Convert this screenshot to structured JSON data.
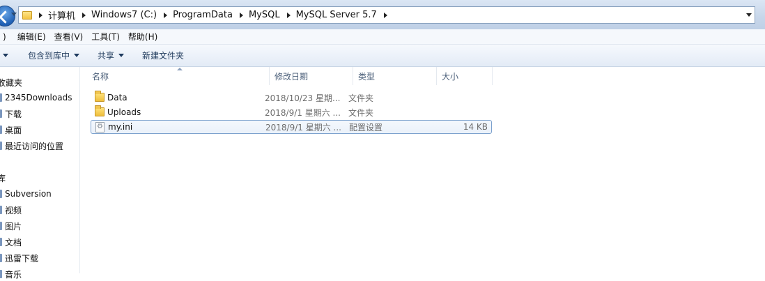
{
  "address_bar": {
    "breadcrumbs": [
      "计算机",
      "Windows7 (C:)",
      "ProgramData",
      "MySQL",
      "MySQL Server 5.7"
    ]
  },
  "menu": {
    "items": [
      "编辑(E)",
      "查看(V)",
      "工具(T)",
      "帮助(H)"
    ],
    "partial_first": ")"
  },
  "toolbar": {
    "include_in_library": "包含到库中",
    "share": "共享",
    "new_folder": "新建文件夹"
  },
  "nav_pane": {
    "favorites_header": "收藏夹",
    "favorites": [
      "2345Downloads",
      "下载",
      "桌面",
      "最近访问的位置"
    ],
    "libraries_header": "库",
    "libraries": [
      "Subversion",
      "视频",
      "图片",
      "文档",
      "迅雷下载",
      "音乐"
    ]
  },
  "columns": {
    "name": "名称",
    "date": "修改日期",
    "type": "类型",
    "size": "大小"
  },
  "files": [
    {
      "name": "Data",
      "date": "2018/10/23 星期...",
      "type": "文件夹",
      "size": "",
      "icon": "folder-icon"
    },
    {
      "name": "Uploads",
      "date": "2018/9/1 星期六 ...",
      "type": "文件夹",
      "size": "",
      "icon": "folder-icon"
    },
    {
      "name": "my.ini",
      "date": "2018/9/1 星期六 ...",
      "type": "配置设置",
      "size": "14 KB",
      "icon": "ini-file-icon"
    }
  ]
}
